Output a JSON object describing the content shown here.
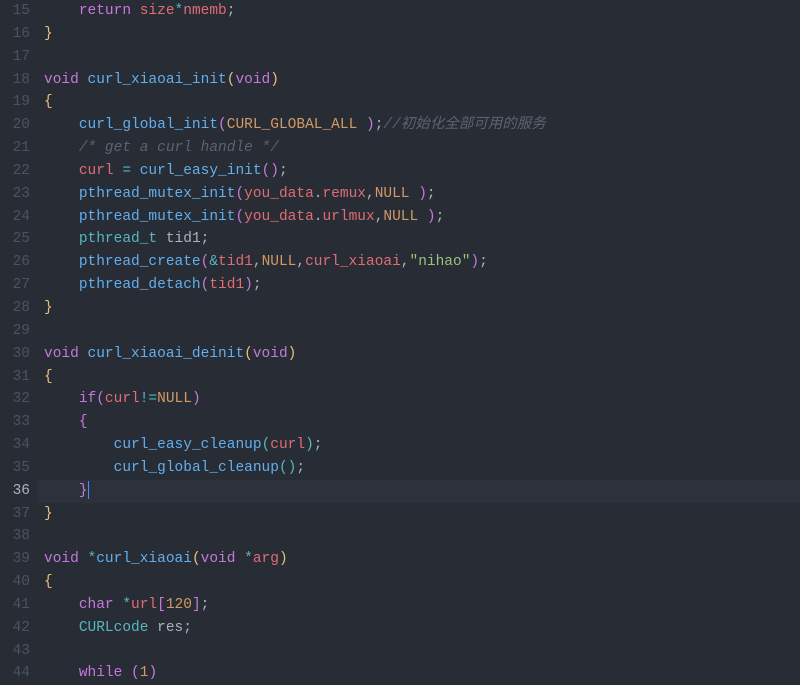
{
  "firstLine": 15,
  "activeLine": 36,
  "lines": [
    {
      "n": 15,
      "tokens": [
        {
          "t": "    ",
          "c": "txt"
        },
        {
          "t": "return",
          "c": "kw"
        },
        {
          "t": " size",
          "c": "id"
        },
        {
          "t": "*",
          "c": "op"
        },
        {
          "t": "nmemb",
          "c": "id"
        },
        {
          "t": ";",
          "c": "punc"
        }
      ]
    },
    {
      "n": 16,
      "tokens": [
        {
          "t": "}",
          "c": "brace"
        }
      ]
    },
    {
      "n": 17,
      "tokens": []
    },
    {
      "n": 18,
      "tokens": [
        {
          "t": "void",
          "c": "type"
        },
        {
          "t": " ",
          "c": "txt"
        },
        {
          "t": "curl_xiaoai_init",
          "c": "fn"
        },
        {
          "t": "(",
          "c": "brace"
        },
        {
          "t": "void",
          "c": "type"
        },
        {
          "t": ")",
          "c": "brace"
        }
      ]
    },
    {
      "n": 19,
      "tokens": [
        {
          "t": "{",
          "c": "brace"
        }
      ]
    },
    {
      "n": 20,
      "tokens": [
        {
          "t": "    ",
          "c": "txt"
        },
        {
          "t": "curl_global_init",
          "c": "fn"
        },
        {
          "t": "(",
          "c": "brace2"
        },
        {
          "t": "CURL_GLOBAL_ALL ",
          "c": "const"
        },
        {
          "t": ")",
          "c": "brace2"
        },
        {
          "t": ";",
          "c": "punc"
        },
        {
          "t": "//初始化全部可用的服务",
          "c": "cmt"
        }
      ]
    },
    {
      "n": 21,
      "tokens": [
        {
          "t": "    ",
          "c": "txt"
        },
        {
          "t": "/* get a curl handle */",
          "c": "cmt"
        }
      ]
    },
    {
      "n": 22,
      "tokens": [
        {
          "t": "    ",
          "c": "txt"
        },
        {
          "t": "curl",
          "c": "id"
        },
        {
          "t": " ",
          "c": "txt"
        },
        {
          "t": "=",
          "c": "op"
        },
        {
          "t": " ",
          "c": "txt"
        },
        {
          "t": "curl_easy_init",
          "c": "fn"
        },
        {
          "t": "(",
          "c": "brace2"
        },
        {
          "t": ")",
          "c": "brace2"
        },
        {
          "t": ";",
          "c": "punc"
        }
      ]
    },
    {
      "n": 23,
      "tokens": [
        {
          "t": "    ",
          "c": "txt"
        },
        {
          "t": "pthread_mutex_init",
          "c": "fn"
        },
        {
          "t": "(",
          "c": "brace2"
        },
        {
          "t": "you_data",
          "c": "id"
        },
        {
          "t": ".",
          "c": "punc"
        },
        {
          "t": "remux",
          "c": "id"
        },
        {
          "t": ",",
          "c": "punc"
        },
        {
          "t": "NULL ",
          "c": "const"
        },
        {
          "t": ")",
          "c": "brace2"
        },
        {
          "t": ";",
          "c": "punc"
        }
      ]
    },
    {
      "n": 24,
      "tokens": [
        {
          "t": "    ",
          "c": "txt"
        },
        {
          "t": "pthread_mutex_init",
          "c": "fn"
        },
        {
          "t": "(",
          "c": "brace2"
        },
        {
          "t": "you_data",
          "c": "id"
        },
        {
          "t": ".",
          "c": "punc"
        },
        {
          "t": "urlmux",
          "c": "id"
        },
        {
          "t": ",",
          "c": "punc"
        },
        {
          "t": "NULL ",
          "c": "const"
        },
        {
          "t": ")",
          "c": "brace2"
        },
        {
          "t": ";",
          "c": "punc"
        }
      ]
    },
    {
      "n": 25,
      "tokens": [
        {
          "t": "    ",
          "c": "txt"
        },
        {
          "t": "pthread_t",
          "c": "typename"
        },
        {
          "t": " tid1",
          "c": "txt"
        },
        {
          "t": ";",
          "c": "punc"
        }
      ]
    },
    {
      "n": 26,
      "tokens": [
        {
          "t": "    ",
          "c": "txt"
        },
        {
          "t": "pthread_create",
          "c": "fn"
        },
        {
          "t": "(",
          "c": "brace2"
        },
        {
          "t": "&",
          "c": "op"
        },
        {
          "t": "tid1",
          "c": "id"
        },
        {
          "t": ",",
          "c": "punc"
        },
        {
          "t": "NULL",
          "c": "const"
        },
        {
          "t": ",",
          "c": "punc"
        },
        {
          "t": "curl_xiaoai",
          "c": "id"
        },
        {
          "t": ",",
          "c": "punc"
        },
        {
          "t": "\"nihao\"",
          "c": "str"
        },
        {
          "t": ")",
          "c": "brace2"
        },
        {
          "t": ";",
          "c": "punc"
        }
      ]
    },
    {
      "n": 27,
      "tokens": [
        {
          "t": "    ",
          "c": "txt"
        },
        {
          "t": "pthread_detach",
          "c": "fn"
        },
        {
          "t": "(",
          "c": "brace2"
        },
        {
          "t": "tid1",
          "c": "id"
        },
        {
          "t": ")",
          "c": "brace2"
        },
        {
          "t": ";",
          "c": "punc"
        }
      ]
    },
    {
      "n": 28,
      "tokens": [
        {
          "t": "}",
          "c": "brace"
        }
      ]
    },
    {
      "n": 29,
      "tokens": []
    },
    {
      "n": 30,
      "tokens": [
        {
          "t": "void",
          "c": "type"
        },
        {
          "t": " ",
          "c": "txt"
        },
        {
          "t": "curl_xiaoai_deinit",
          "c": "fn"
        },
        {
          "t": "(",
          "c": "brace"
        },
        {
          "t": "void",
          "c": "type"
        },
        {
          "t": ")",
          "c": "brace"
        }
      ]
    },
    {
      "n": 31,
      "tokens": [
        {
          "t": "{",
          "c": "brace"
        }
      ]
    },
    {
      "n": 32,
      "tokens": [
        {
          "t": "    ",
          "c": "txt"
        },
        {
          "t": "if",
          "c": "kw"
        },
        {
          "t": "(",
          "c": "brace2"
        },
        {
          "t": "curl",
          "c": "id"
        },
        {
          "t": "!=",
          "c": "op"
        },
        {
          "t": "NULL",
          "c": "const"
        },
        {
          "t": ")",
          "c": "brace2"
        }
      ]
    },
    {
      "n": 33,
      "tokens": [
        {
          "t": "    ",
          "c": "txt"
        },
        {
          "t": "{",
          "c": "brace2"
        }
      ]
    },
    {
      "n": 34,
      "tokens": [
        {
          "t": "        ",
          "c": "txt"
        },
        {
          "t": "curl_easy_cleanup",
          "c": "fn"
        },
        {
          "t": "(",
          "c": "brace3"
        },
        {
          "t": "curl",
          "c": "id"
        },
        {
          "t": ")",
          "c": "brace3"
        },
        {
          "t": ";",
          "c": "punc"
        }
      ]
    },
    {
      "n": 35,
      "tokens": [
        {
          "t": "        ",
          "c": "txt"
        },
        {
          "t": "curl_global_cleanup",
          "c": "fn"
        },
        {
          "t": "(",
          "c": "brace3"
        },
        {
          "t": ")",
          "c": "brace3"
        },
        {
          "t": ";",
          "c": "punc"
        }
      ]
    },
    {
      "n": 36,
      "tokens": [
        {
          "t": "    ",
          "c": "txt"
        },
        {
          "t": "}",
          "c": "brace2"
        }
      ],
      "active": true
    },
    {
      "n": 37,
      "tokens": [
        {
          "t": "}",
          "c": "brace"
        }
      ]
    },
    {
      "n": 38,
      "tokens": []
    },
    {
      "n": 39,
      "tokens": [
        {
          "t": "void",
          "c": "type"
        },
        {
          "t": " ",
          "c": "txt"
        },
        {
          "t": "*",
          "c": "op"
        },
        {
          "t": "curl_xiaoai",
          "c": "fn"
        },
        {
          "t": "(",
          "c": "brace"
        },
        {
          "t": "void",
          "c": "type"
        },
        {
          "t": " ",
          "c": "txt"
        },
        {
          "t": "*",
          "c": "op"
        },
        {
          "t": "arg",
          "c": "id"
        },
        {
          "t": ")",
          "c": "brace"
        }
      ]
    },
    {
      "n": 40,
      "tokens": [
        {
          "t": "{",
          "c": "brace"
        }
      ]
    },
    {
      "n": 41,
      "tokens": [
        {
          "t": "    ",
          "c": "txt"
        },
        {
          "t": "char",
          "c": "type"
        },
        {
          "t": " ",
          "c": "txt"
        },
        {
          "t": "*",
          "c": "op"
        },
        {
          "t": "url",
          "c": "id"
        },
        {
          "t": "[",
          "c": "brace2"
        },
        {
          "t": "120",
          "c": "num"
        },
        {
          "t": "]",
          "c": "brace2"
        },
        {
          "t": ";",
          "c": "punc"
        }
      ]
    },
    {
      "n": 42,
      "tokens": [
        {
          "t": "    ",
          "c": "txt"
        },
        {
          "t": "CURLcode",
          "c": "typename"
        },
        {
          "t": " res",
          "c": "txt"
        },
        {
          "t": ";",
          "c": "punc"
        }
      ]
    },
    {
      "n": 43,
      "tokens": []
    },
    {
      "n": 44,
      "tokens": [
        {
          "t": "    ",
          "c": "txt"
        },
        {
          "t": "while",
          "c": "kw"
        },
        {
          "t": " ",
          "c": "txt"
        },
        {
          "t": "(",
          "c": "brace2"
        },
        {
          "t": "1",
          "c": "num"
        },
        {
          "t": ")",
          "c": "brace2"
        }
      ]
    }
  ]
}
